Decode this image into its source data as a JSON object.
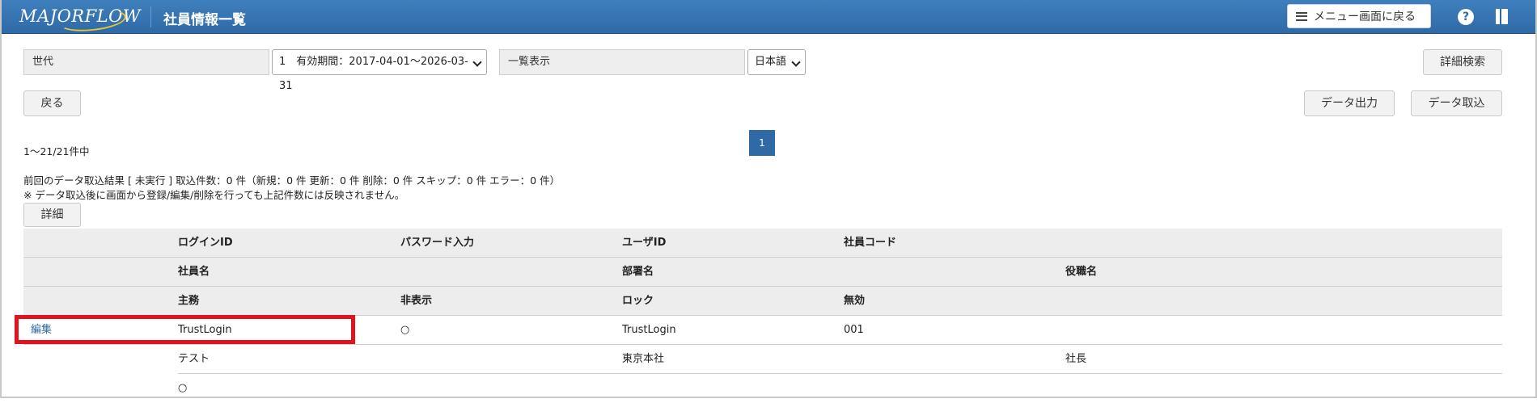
{
  "header": {
    "logo_text": "MAJORFLOW",
    "title": "社員情報一覧",
    "menu_back_label": "メニュー画面に戻る",
    "help_label": "?",
    "icons": [
      "menu-icon",
      "help-icon",
      "book-icon"
    ]
  },
  "controls": {
    "generation_label": "世代",
    "generation_select": "1　有効期間：2017-04-01～2026-03-31",
    "view_label": "一覧表示",
    "language_select": "日本語",
    "detail_search": "詳細検索",
    "back_button": "戻る",
    "data_export": "データ出力",
    "data_import": "データ取込"
  },
  "pagination": {
    "current_page": "1",
    "count_text": "1～21/21件中"
  },
  "import_result": {
    "line1": "前回のデータ取込結果 [ 未実行 ] 取込件数：0 件（新規：0 件 更新：0 件 削除：0 件 スキップ：0 件 エラー：0 件）",
    "line2": "※ データ取込後に画面から登録/編集/削除を行っても上記件数には反映されません。",
    "detail_button": "詳細"
  },
  "table": {
    "header_rows": [
      [
        "",
        "ログインID",
        "パスワード入力",
        "ユーザID",
        "社員コード",
        ""
      ],
      [
        "",
        "社員名",
        "",
        "部署名",
        "",
        "役職名"
      ],
      [
        "",
        "主務",
        "非表示",
        "ロック",
        "無効",
        ""
      ]
    ],
    "record": {
      "edit_label": "編集",
      "row1": [
        "TrustLogin",
        "○",
        "TrustLogin",
        "001",
        ""
      ],
      "row2": [
        "テスト",
        "",
        "東京本社",
        "",
        "社長"
      ],
      "row3": [
        "○",
        "",
        "",
        "",
        ""
      ]
    }
  },
  "colors": {
    "header_bar": "#2f6aa6",
    "link": "#2f6aa6",
    "highlight": "#e0141e"
  }
}
